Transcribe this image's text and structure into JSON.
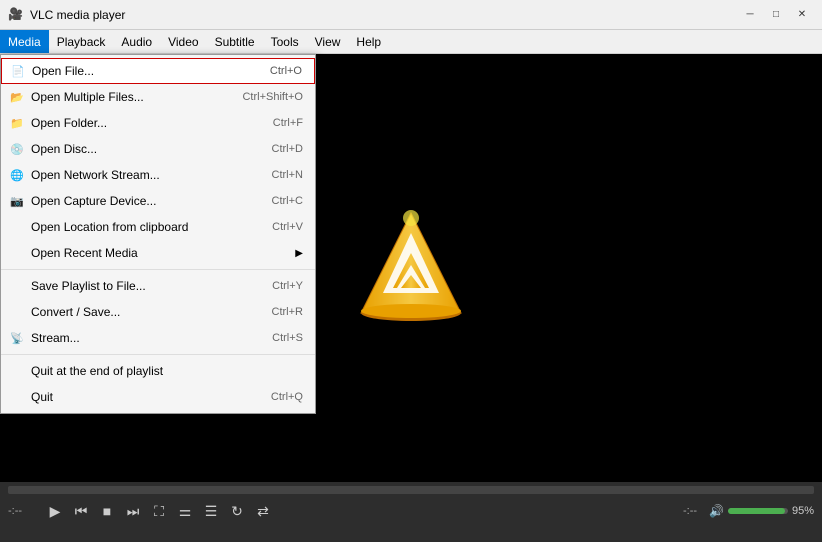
{
  "titleBar": {
    "icon": "🎥",
    "title": "VLC media player",
    "minimizeLabel": "─",
    "maximizeLabel": "□",
    "closeLabel": "✕"
  },
  "menuBar": {
    "items": [
      {
        "id": "media",
        "label": "Media",
        "active": true
      },
      {
        "id": "playback",
        "label": "Playback",
        "active": false
      },
      {
        "id": "audio",
        "label": "Audio",
        "active": false
      },
      {
        "id": "video",
        "label": "Video",
        "active": false
      },
      {
        "id": "subtitle",
        "label": "Subtitle",
        "active": false
      },
      {
        "id": "tools",
        "label": "Tools",
        "active": false
      },
      {
        "id": "view",
        "label": "View",
        "active": false
      },
      {
        "id": "help",
        "label": "Help",
        "active": false
      }
    ]
  },
  "dropdown": {
    "sections": [
      {
        "items": [
          {
            "id": "open-file",
            "label": "Open File...",
            "shortcut": "Ctrl+O",
            "highlighted": true,
            "icon": "📄"
          },
          {
            "id": "open-multiple",
            "label": "Open Multiple Files...",
            "shortcut": "Ctrl+Shift+O",
            "highlighted": false,
            "icon": "📂"
          },
          {
            "id": "open-folder",
            "label": "Open Folder...",
            "shortcut": "Ctrl+F",
            "highlighted": false,
            "icon": "📁"
          },
          {
            "id": "open-disc",
            "label": "Open Disc...",
            "shortcut": "Ctrl+D",
            "highlighted": false,
            "icon": "💿"
          },
          {
            "id": "open-network",
            "label": "Open Network Stream...",
            "shortcut": "Ctrl+N",
            "highlighted": false,
            "icon": "🌐"
          },
          {
            "id": "open-capture",
            "label": "Open Capture Device...",
            "shortcut": "Ctrl+C",
            "highlighted": false,
            "icon": "📷"
          },
          {
            "id": "open-location",
            "label": "Open Location from clipboard",
            "shortcut": "Ctrl+V",
            "highlighted": false,
            "icon": ""
          },
          {
            "id": "open-recent",
            "label": "Open Recent Media",
            "shortcut": "",
            "hasSubmenu": true,
            "highlighted": false,
            "icon": ""
          }
        ]
      },
      {
        "items": [
          {
            "id": "save-playlist",
            "label": "Save Playlist to File...",
            "shortcut": "Ctrl+Y",
            "highlighted": false,
            "icon": ""
          },
          {
            "id": "convert",
            "label": "Convert / Save...",
            "shortcut": "Ctrl+R",
            "highlighted": false,
            "icon": ""
          },
          {
            "id": "stream",
            "label": "Stream...",
            "shortcut": "Ctrl+S",
            "highlighted": false,
            "icon": "📡"
          }
        ]
      },
      {
        "items": [
          {
            "id": "quit-end",
            "label": "Quit at the end of playlist",
            "shortcut": "",
            "highlighted": false,
            "icon": ""
          },
          {
            "id": "quit",
            "label": "Quit",
            "shortcut": "Ctrl+Q",
            "highlighted": false,
            "icon": ""
          }
        ]
      }
    ]
  },
  "bottomControls": {
    "timeLeft": "-:--",
    "timeRight": "-:--",
    "volumePercent": "95%",
    "buttons": [
      {
        "id": "play",
        "icon": "▶",
        "label": "Play"
      },
      {
        "id": "prev",
        "icon": "⏮",
        "label": "Previous"
      },
      {
        "id": "stop",
        "icon": "■",
        "label": "Stop"
      },
      {
        "id": "next",
        "icon": "⏭",
        "label": "Next"
      },
      {
        "id": "fullscreen",
        "icon": "⛶",
        "label": "Fullscreen"
      },
      {
        "id": "extended",
        "icon": "⚌",
        "label": "Extended"
      },
      {
        "id": "playlist",
        "icon": "☰",
        "label": "Playlist"
      },
      {
        "id": "loop",
        "icon": "🔁",
        "label": "Loop"
      },
      {
        "id": "random",
        "icon": "🔀",
        "label": "Random"
      }
    ]
  }
}
